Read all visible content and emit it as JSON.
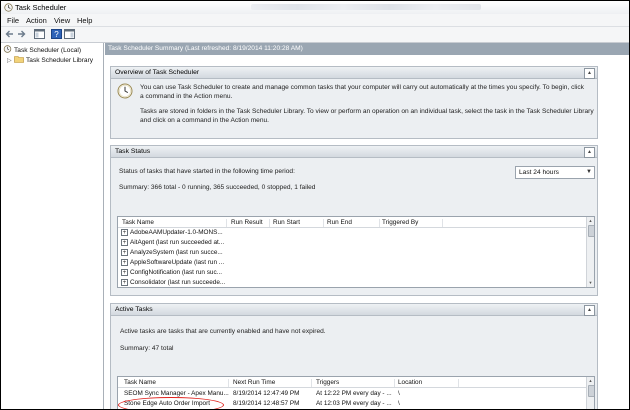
{
  "window": {
    "title": "Task Scheduler"
  },
  "menu": [
    "File",
    "Action",
    "View",
    "Help"
  ],
  "tree": {
    "root": "Task Scheduler (Local)",
    "child": "Task Scheduler Library"
  },
  "summary_header": "Task Scheduler Summary (Last refreshed: 8/19/2014 11:20:28 AM)",
  "overview": {
    "title": "Overview of Task Scheduler",
    "para1_line1": "You can use Task Scheduler to create and manage common tasks that your computer will carry out automatically at the times you specify. To begin, click",
    "para1_line2": "a command in the Action menu.",
    "para2_line1": "Tasks are stored in folders in the Task Scheduler Library. To view or perform an operation on an individual task, select the task in the Task Scheduler Library",
    "para2_line2": "and click on a command in the Action menu."
  },
  "task_status": {
    "title": "Task Status",
    "period_label": "Status of tasks that have started in the following time period:",
    "period_value": "Last 24 hours",
    "summary": "Summary: 366 total - 0 running, 365 succeeded, 0 stopped, 1 failed",
    "columns": [
      "Task Name",
      "Run Result",
      "Run Start",
      "Run End",
      "Triggered By"
    ],
    "rows": [
      "AdobeAAMUpdater-1.0-MONS...",
      "AitAgent (last run succeeded at...",
      "AnalyzeSystem (last run succe...",
      "AppleSoftwareUpdate (last run ...",
      "ConfigNotification (last run suc...",
      "Consolidator (last run succeede..."
    ]
  },
  "active_tasks": {
    "title": "Active Tasks",
    "description": "Active tasks are tasks that are currently enabled and have not expired.",
    "summary": "Summary: 47 total",
    "columns": [
      "Task Name",
      "Next Run Time",
      "Triggers",
      "Location"
    ],
    "rows": [
      {
        "name": "SEOM Sync Manager - Apex Manu...",
        "next": "8/19/2014 12:47:49 PM",
        "triggers": "At 12:22 PM every day - ...",
        "location": "\\"
      },
      {
        "name": "Stone Edge Auto Order Import",
        "next": "8/19/2014 12:48:57 PM",
        "triggers": "At 12:03 PM every day - ...",
        "location": "\\"
      }
    ]
  },
  "colors": {
    "annotation": "#e0211c",
    "header_bar": "#9aa6b2"
  }
}
